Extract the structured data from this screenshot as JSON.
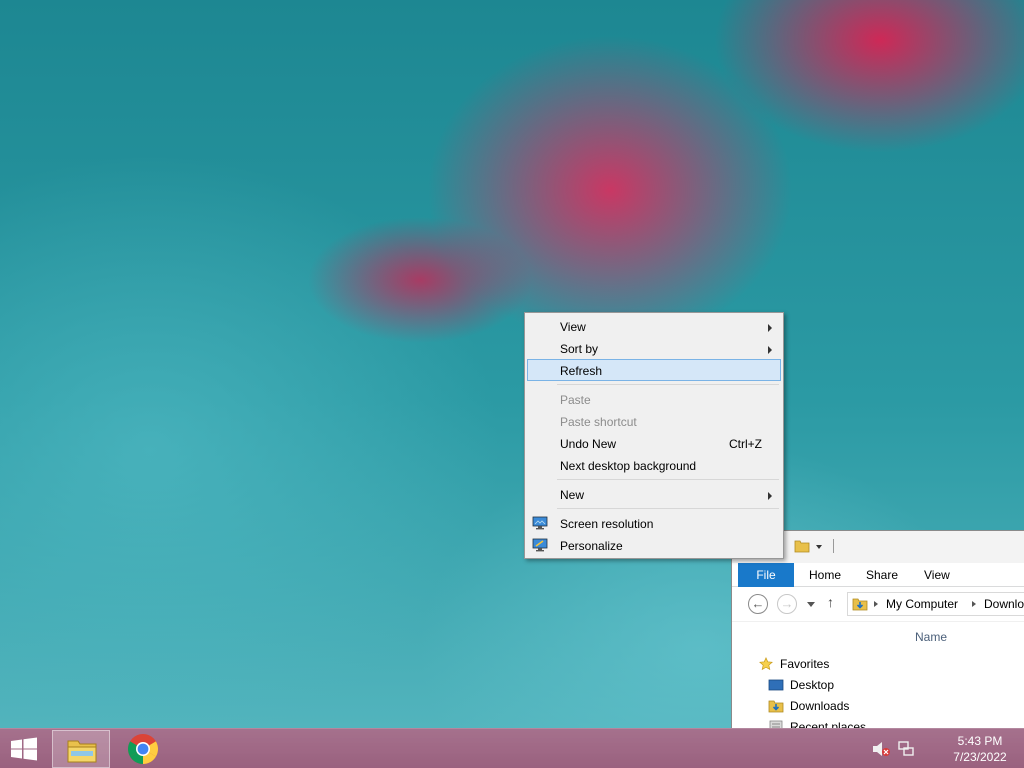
{
  "context_menu": {
    "items": [
      {
        "label": "View",
        "submenu": true
      },
      {
        "label": "Sort by",
        "submenu": true
      },
      {
        "label": "Refresh",
        "highlighted": true
      },
      {
        "label": "Paste",
        "disabled": true
      },
      {
        "label": "Paste shortcut",
        "disabled": true
      },
      {
        "label": "Undo New",
        "shortcut": "Ctrl+Z"
      },
      {
        "label": "Next desktop background"
      },
      {
        "label": "New",
        "submenu": true
      },
      {
        "label": "Screen resolution",
        "icon": "monitor-icon"
      },
      {
        "label": "Personalize",
        "icon": "personalize-icon"
      }
    ]
  },
  "explorer": {
    "ribbon_tabs": [
      "File",
      "Home",
      "Share",
      "View"
    ],
    "address": {
      "segments": [
        "My Computer",
        "Downloads"
      ]
    },
    "column_header": "Name",
    "nav_pane": {
      "favorites": "Favorites",
      "items": [
        "Desktop",
        "Downloads",
        "Recent places"
      ]
    }
  },
  "taskbar": {
    "pinned": [
      {
        "name": "File Explorer",
        "icon": "folder-icon",
        "active": true
      },
      {
        "name": "Google Chrome",
        "icon": "chrome-icon",
        "active": false
      }
    ],
    "clock": {
      "time": "5:43 PM",
      "date": "7/23/2022"
    }
  },
  "colors": {
    "menu_highlight": "#d5e7f8",
    "file_tab": "#1979ca",
    "taskbar": "#b06e8c"
  }
}
